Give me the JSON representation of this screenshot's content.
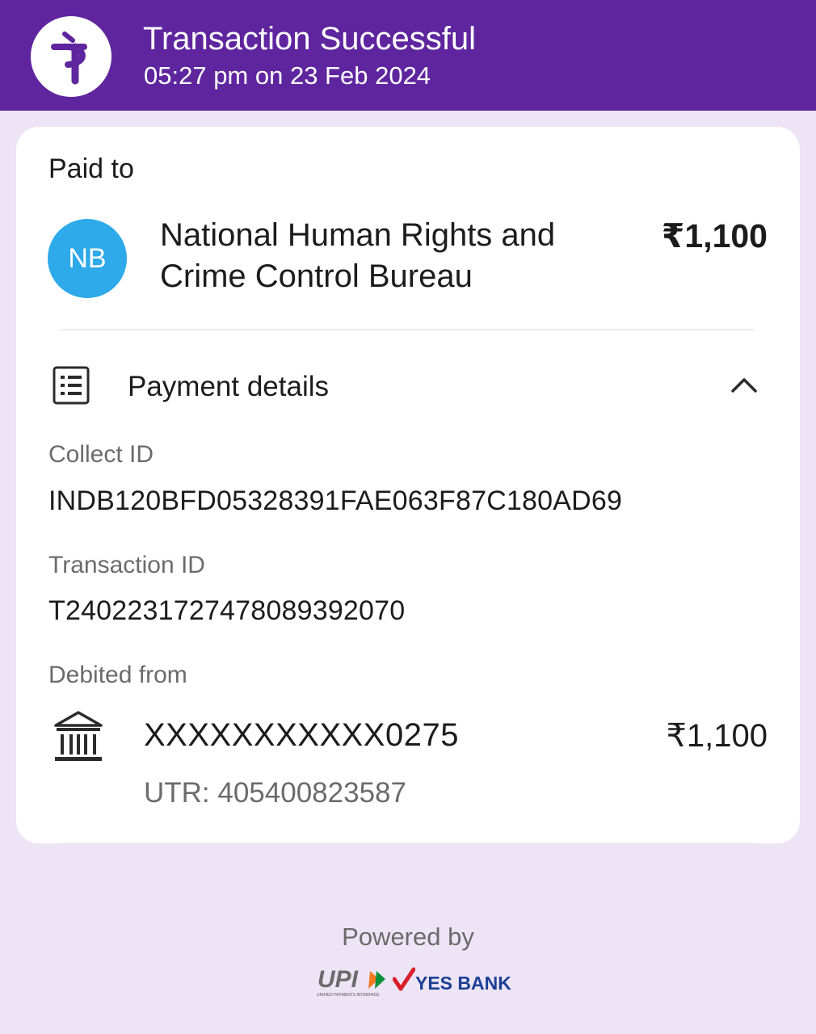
{
  "header": {
    "title": "Transaction Successful",
    "timestamp": "05:27 pm on 23 Feb 2024",
    "logo_icon": "phonepe-logo-icon",
    "brand_color": "#5f259f"
  },
  "paid_to": {
    "label": "Paid to",
    "avatar_initials": "NB",
    "avatar_color": "#2ea9ea",
    "name": "National Human Rights and Crime Control Bureau",
    "amount": "₹1,100"
  },
  "payment_details": {
    "title": "Payment details",
    "icon": "receipt-list-icon",
    "expanded": true,
    "collect_id_label": "Collect ID",
    "collect_id": "INDB120BFD05328391FAE063F87C180AD69",
    "transaction_id_label": "Transaction ID",
    "transaction_id": "T2402231727478089392070",
    "debited_from_label": "Debited from",
    "bank_icon": "bank-icon",
    "account": "XXXXXXXXXXX0275",
    "debit_amount": "₹1,100",
    "utr": "UTR: 405400823587"
  },
  "footer": {
    "powered_by": "Powered by",
    "upi_logo_text": "UPI",
    "upi_tagline": "UNIFIED PAYMENTS INTERFACE",
    "bank_name": "YES BANK"
  }
}
